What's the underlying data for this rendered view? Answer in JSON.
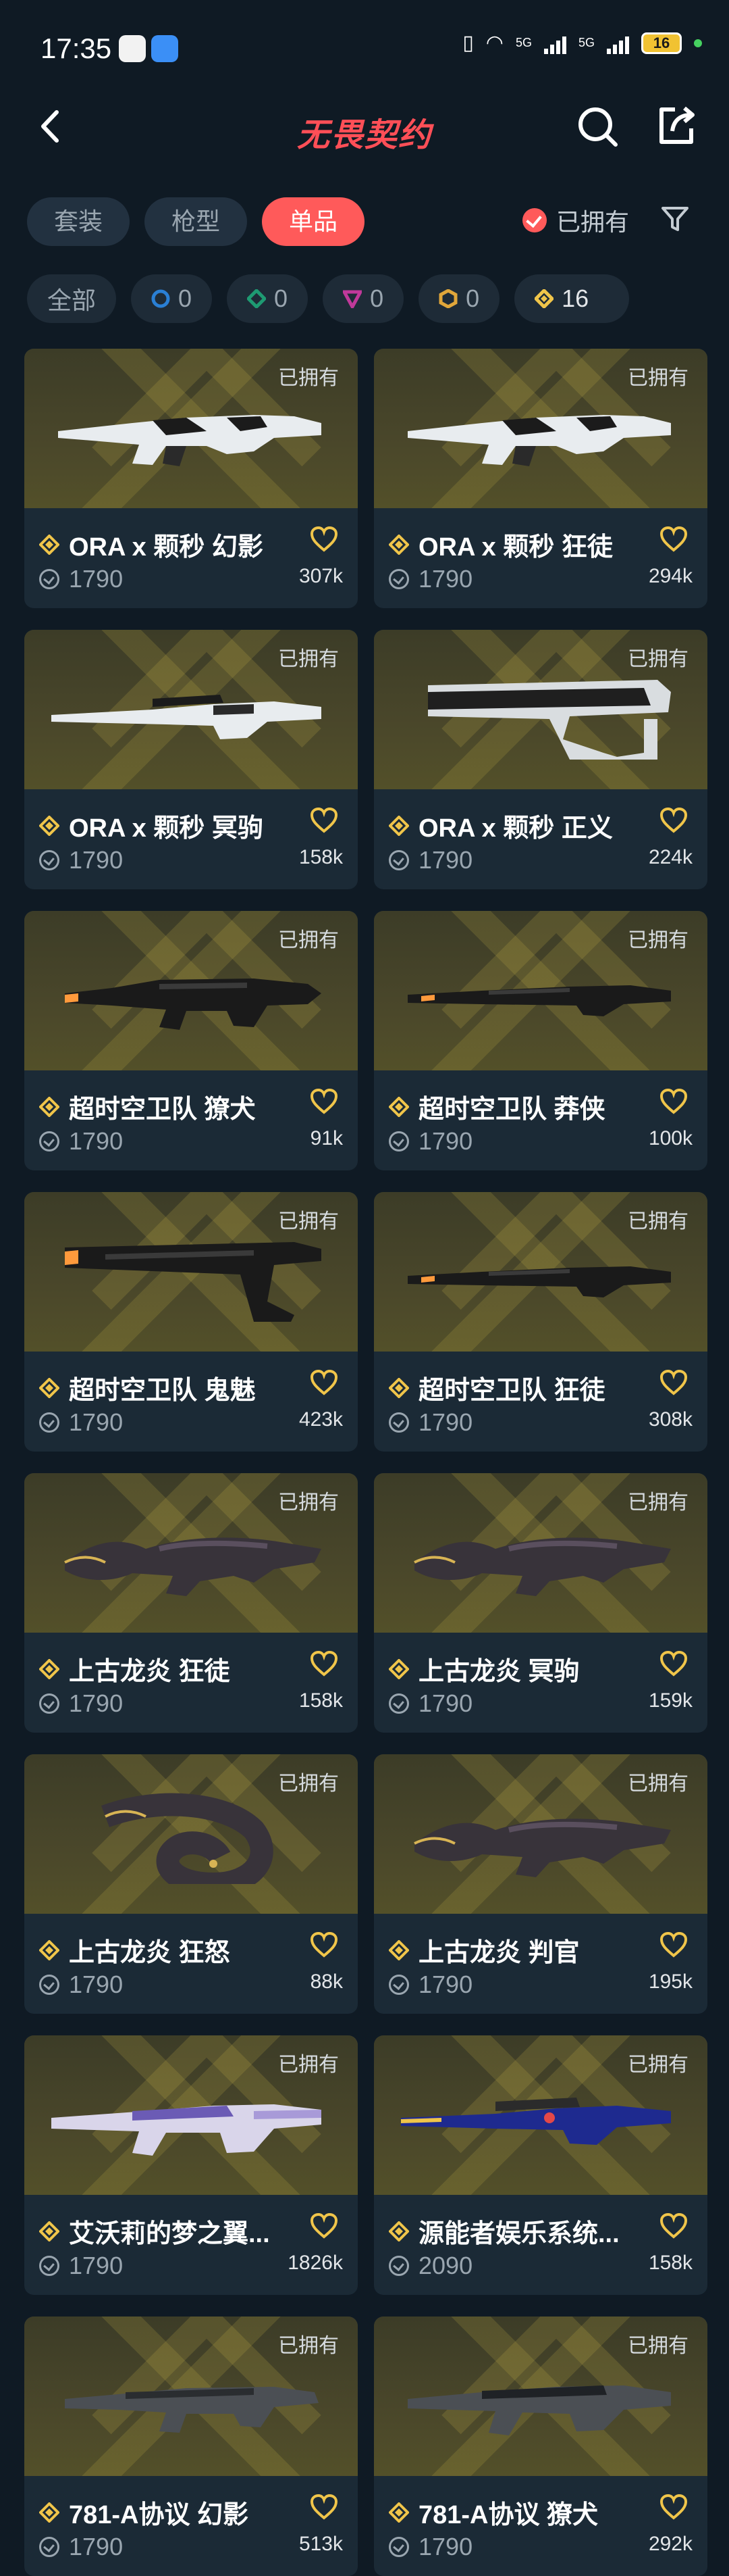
{
  "status": {
    "time": "17:35",
    "battery": "16",
    "network1": "5G",
    "network2": "5G"
  },
  "header": {
    "title": "无畏契约"
  },
  "tabs": [
    {
      "label": "套装",
      "active": false
    },
    {
      "label": "枪型",
      "active": false
    },
    {
      "label": "单品",
      "active": true
    }
  ],
  "owned_filter": {
    "label": "已拥有",
    "checked": true
  },
  "chips": [
    {
      "label": "全部"
    },
    {
      "count": "0",
      "gem_color": "#2a7fd4"
    },
    {
      "count": "0",
      "gem_color": "#1e9a72"
    },
    {
      "count": "0",
      "gem_color": "#c0399a"
    },
    {
      "count": "0",
      "gem_color": "#e0a63a"
    },
    {
      "count": "16",
      "gem_color": "#f0c54a"
    }
  ],
  "items": [
    {
      "name": "ORA x 颗秒 幻影",
      "price": "1790",
      "likes": "307k",
      "owned": "已拥有",
      "gun": "rifle-white"
    },
    {
      "name": "ORA x 颗秒 狂徒",
      "price": "1790",
      "likes": "294k",
      "owned": "已拥有",
      "gun": "rifle-white"
    },
    {
      "name": "ORA x 颗秒 冥驹",
      "price": "1790",
      "likes": "158k",
      "owned": "已拥有",
      "gun": "sniper-white"
    },
    {
      "name": "ORA x 颗秒 正义",
      "price": "1790",
      "likes": "224k",
      "owned": "已拥有",
      "gun": "pistol-white"
    },
    {
      "name": "超时空卫队 獠犬",
      "price": "1790",
      "likes": "91k",
      "owned": "已拥有",
      "gun": "smg-dark"
    },
    {
      "name": "超时空卫队 莽侠",
      "price": "1790",
      "likes": "100k",
      "owned": "已拥有",
      "gun": "rifle-dark"
    },
    {
      "name": "超时空卫队 鬼魅",
      "price": "1790",
      "likes": "423k",
      "owned": "已拥有",
      "gun": "pistol-dark"
    },
    {
      "name": "超时空卫队 狂徒",
      "price": "1790",
      "likes": "308k",
      "owned": "已拥有",
      "gun": "rifle-dark"
    },
    {
      "name": "上古龙炎 狂徒",
      "price": "1790",
      "likes": "158k",
      "owned": "已拥有",
      "gun": "dragon"
    },
    {
      "name": "上古龙炎 冥驹",
      "price": "1790",
      "likes": "159k",
      "owned": "已拥有",
      "gun": "dragon"
    },
    {
      "name": "上古龙炎 狂怒",
      "price": "1790",
      "likes": "88k",
      "owned": "已拥有",
      "gun": "dragon-coil"
    },
    {
      "name": "上古龙炎 判官",
      "price": "1790",
      "likes": "195k",
      "owned": "已拥有",
      "gun": "dragon"
    },
    {
      "name": "艾沃莉的梦之翼...",
      "price": "1790",
      "likes": "1826k",
      "owned": "已拥有",
      "gun": "rifle-purple"
    },
    {
      "name": "源能者娱乐系统...",
      "price": "2090",
      "likes": "158k",
      "owned": "已拥有",
      "gun": "sniper-blue"
    },
    {
      "name": "781-A协议 幻影",
      "price": "1790",
      "likes": "513k",
      "owned": "已拥有",
      "gun": "smg-grey"
    },
    {
      "name": "781-A协议 獠犬",
      "price": "1790",
      "likes": "292k",
      "owned": "已拥有",
      "gun": "rifle-grey"
    }
  ]
}
